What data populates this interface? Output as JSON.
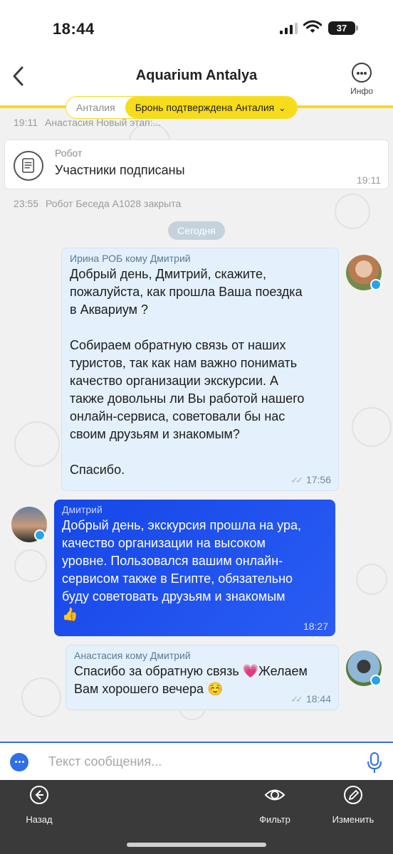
{
  "status_bar": {
    "time": "18:44",
    "battery": "37"
  },
  "header": {
    "title": "Aquarium Antalya",
    "info_label": "Инфо"
  },
  "chips": {
    "city": "Анталия",
    "status": "Бронь подтверждена Анталия"
  },
  "system_messages": [
    {
      "time": "19:11",
      "text": "Анастасия Новый этап:..."
    },
    {
      "time": "23:55",
      "text": "Робот Беседа A1028 закрыта"
    }
  ],
  "robot_card": {
    "sender": "Робот",
    "text": "Участники подписаны",
    "time": "19:11"
  },
  "date_separator": "Сегодня",
  "messages": [
    {
      "sender": "Ирина РОБ кому Дмитрий",
      "text": "Добрый день, Дмитрий, скажите,\nпожалуйста, как прошла Ваша поездка\nв Аквариум ?\n\nСобираем обратную связь от наших\nтуристов, так как нам важно понимать\nкачество организации экскурсии. А\nтакже довольны ли Вы работой нашего\nонлайн-сервиса, советовали бы нас\nсвоим друзьям и знакомым?\n\nСпасибо.",
      "time": "17:56",
      "direction": "in"
    },
    {
      "sender": "Дмитрий",
      "text": "Добрый день, экскурсия прошла на ура,\nкачество организации на высоком\nуровне. Пользовался вашим онлайн-\nсервисом также в Египте, обязательно\nбуду советовать друзьям и знакомым\n👍",
      "time": "18:27",
      "direction": "out"
    },
    {
      "sender": "Анастасия кому Дмитрий",
      "text": "Спасибо за обратную связь 💗Желаем\nВам хорошего вечера ☺️",
      "time": "18:44",
      "direction": "in"
    }
  ],
  "input": {
    "placeholder": "Текст сообщения..."
  },
  "toolbar": {
    "back_label": "Назад",
    "filter_label": "Фильтр",
    "edit_label": "Изменить"
  },
  "colors": {
    "accent_yellow": "#f6dc1c",
    "accent_blue": "#1f4ff0",
    "incoming_bubble": "#e4f0fb",
    "toolbar_bg": "#3a3a3a"
  }
}
